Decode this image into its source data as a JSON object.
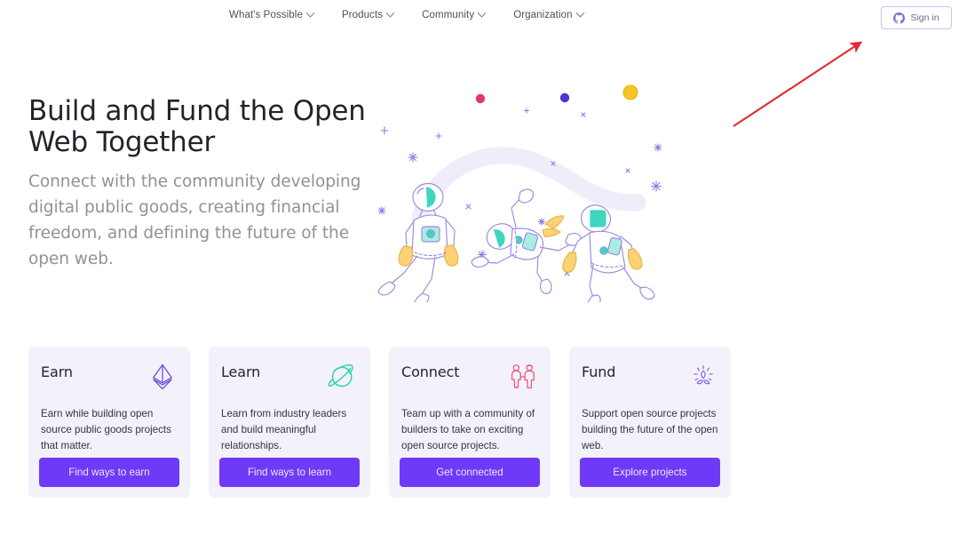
{
  "nav": {
    "items": [
      {
        "label": "What's Possible",
        "icon": "chevron-down-icon"
      },
      {
        "label": "Products",
        "icon": "chevron-down-icon"
      },
      {
        "label": "Community",
        "icon": "chevron-down-icon"
      },
      {
        "label": "Organization",
        "icon": "chevron-down-icon"
      }
    ],
    "signin": {
      "label": "Sign in",
      "icon": "github-icon"
    }
  },
  "hero": {
    "title": "Build and Fund the Open Web Together",
    "subtitle": "Connect with the community developing digital public goods, creating financial freedom, and defining the future of the open web.",
    "illustration": "three-astronauts-in-space-illustration"
  },
  "cards": [
    {
      "title": "Earn",
      "icon": "ethereum-diamond-icon",
      "icon_color": "#6E4BD6",
      "body": "Earn while building open source public goods projects that matter.",
      "button": "Find ways to earn"
    },
    {
      "title": "Learn",
      "icon": "planet-icon",
      "icon_color": "#2BD4A0",
      "body": "Learn from industry leaders and build meaningful relationships.",
      "button": "Find ways to learn"
    },
    {
      "title": "Connect",
      "icon": "two-people-icon",
      "icon_color": "#F4537E",
      "body": "Team up with a community of builders to take on exciting open source projects.",
      "button": "Get connected"
    },
    {
      "title": "Fund",
      "icon": "sprout-sparkle-icon",
      "icon_color": "#8C6BE8",
      "body": "Support open source projects building the future of the open web.",
      "button": "Explore projects"
    }
  ],
  "annotation": {
    "type": "arrow",
    "color": "#E02B2B",
    "points_to": "sign-in-button"
  },
  "colors": {
    "brand_purple": "#6E3AF7",
    "card_background": "#F3F2FA",
    "page_background": "#FFFFFF",
    "heading": "#20252B",
    "subheading": "#8E9399",
    "annotation_red": "#E02B2B"
  }
}
